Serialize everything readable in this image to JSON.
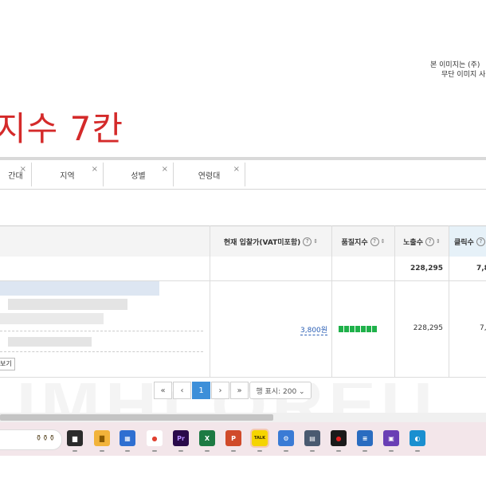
{
  "notice": {
    "line1": "본 이미지는 (주)",
    "line2": "무단 이미지 사"
  },
  "heading": {
    "title": "지수 7칸"
  },
  "filter_tabs": [
    {
      "label": "간대"
    },
    {
      "label": "지역"
    },
    {
      "label": "성별"
    },
    {
      "label": "연령대"
    }
  ],
  "tab_close_glyph": "×",
  "table": {
    "headers": {
      "bid": "현재 입찰가(VAT미포함)",
      "quality": "품질지수",
      "impressions": "노출수",
      "clicks": "클릭수"
    },
    "help_glyph": "?",
    "sort_glyph": "⇕",
    "summary": {
      "impressions": "228,295",
      "clicks": "7,8"
    },
    "row": {
      "bid": "3,800원",
      "quality_level": 7,
      "quality_max": 7,
      "impressions": "228,295",
      "clicks": "7,",
      "view_button": "보기"
    }
  },
  "pagination": {
    "first": "«",
    "prev": "‹",
    "current": "1",
    "next": "›",
    "last": "»",
    "rows_select": "행 표시: 200 ⌄"
  },
  "watermark": {
    "text": "UMHi OREU"
  },
  "colors": {
    "title_red": "#d42a2a",
    "accent_blue": "#3d8fd9",
    "quality_green": "#1fb14a",
    "taskbar": "#f3e6ea"
  },
  "taskbar": {
    "icons": [
      {
        "name": "task-view-icon",
        "glyph": "▆"
      },
      {
        "name": "file-explorer-icon",
        "glyph": "▇"
      },
      {
        "name": "microsoft-store-icon",
        "glyph": "▦"
      },
      {
        "name": "chrome-icon",
        "glyph": "●"
      },
      {
        "name": "premiere-pro-icon",
        "glyph": "Pr"
      },
      {
        "name": "excel-icon",
        "glyph": "X"
      },
      {
        "name": "powerpoint-icon",
        "glyph": "P"
      },
      {
        "name": "kakaotalk-icon",
        "glyph": "TALK"
      },
      {
        "name": "network-tool-icon",
        "glyph": "⚙"
      },
      {
        "name": "calculator-icon",
        "glyph": "▤"
      },
      {
        "name": "record-icon",
        "glyph": "●"
      },
      {
        "name": "notepad-icon",
        "glyph": "≡"
      },
      {
        "name": "sns-app-icon",
        "glyph": "▣"
      },
      {
        "name": "edge-icon",
        "glyph": "◐"
      }
    ]
  }
}
